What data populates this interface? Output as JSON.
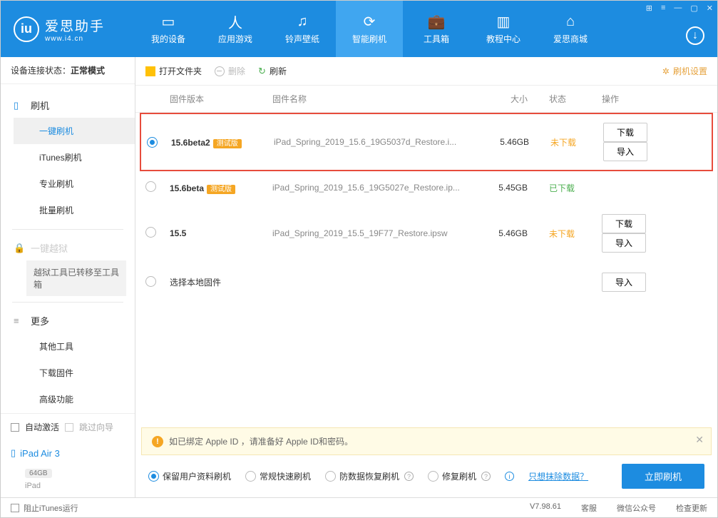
{
  "app": {
    "name": "爱思助手",
    "url": "www.i4.cn"
  },
  "nav": {
    "tabs": [
      {
        "label": "我的设备"
      },
      {
        "label": "应用游戏"
      },
      {
        "label": "铃声壁纸"
      },
      {
        "label": "智能刷机"
      },
      {
        "label": "工具箱"
      },
      {
        "label": "教程中心"
      },
      {
        "label": "爱思商城"
      }
    ]
  },
  "sidebar": {
    "status_label": "设备连接状态：",
    "status_value": "正常模式",
    "flash_header": "刷机",
    "flash_items": [
      {
        "label": "一键刷机"
      },
      {
        "label": "iTunes刷机"
      },
      {
        "label": "专业刷机"
      },
      {
        "label": "批量刷机"
      }
    ],
    "jailbreak_header": "一键越狱",
    "jailbreak_note": "越狱工具已转移至工具箱",
    "more_header": "更多",
    "more_items": [
      {
        "label": "其他工具"
      },
      {
        "label": "下载固件"
      },
      {
        "label": "高级功能"
      }
    ],
    "auto_activate": "自动激活",
    "skip_wizard": "跳过向导",
    "device_name": "iPad Air 3",
    "device_storage": "64GB",
    "device_type": "iPad"
  },
  "toolbar": {
    "open_folder": "打开文件夹",
    "delete": "删除",
    "refresh": "刷新",
    "flash_settings": "刷机设置"
  },
  "table": {
    "h_version": "固件版本",
    "h_name": "固件名称",
    "h_size": "大小",
    "h_status": "状态",
    "h_action": "操作",
    "btn_download": "下载",
    "btn_import": "导入",
    "local_select": "选择本地固件",
    "beta_tag": "测试版",
    "rows": [
      {
        "version": "15.6beta2",
        "beta": true,
        "name": "iPad_Spring_2019_15.6_19G5037d_Restore.i...",
        "size": "5.46GB",
        "status": "未下载",
        "status_cls": "stat-undl",
        "selected": true,
        "highlight": true,
        "show_actions": true
      },
      {
        "version": "15.6beta",
        "beta": true,
        "name": "iPad_Spring_2019_15.6_19G5027e_Restore.ip...",
        "size": "5.45GB",
        "status": "已下载",
        "status_cls": "stat-dl",
        "selected": false,
        "highlight": false,
        "show_actions": false
      },
      {
        "version": "15.5",
        "beta": false,
        "name": "iPad_Spring_2019_15.5_19F77_Restore.ipsw",
        "size": "5.46GB",
        "status": "未下载",
        "status_cls": "stat-undl",
        "selected": false,
        "highlight": false,
        "show_actions": true
      }
    ]
  },
  "warning": "如已绑定 Apple ID ，请准备好 Apple ID和密码。",
  "options": {
    "retain": "保留用户资料刷机",
    "fast": "常规快速刷机",
    "anti": "防数据恢复刷机",
    "repair": "修复刷机",
    "erase_link": "只想抹除数据？",
    "flash_now": "立即刷机"
  },
  "footer": {
    "block_itunes": "阻止iTunes运行",
    "version": "V7.98.61",
    "items": [
      "客服",
      "微信公众号",
      "检查更新"
    ]
  }
}
